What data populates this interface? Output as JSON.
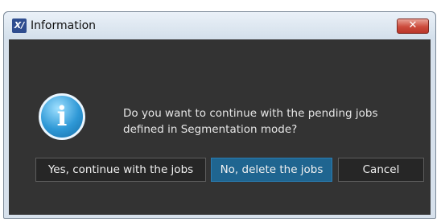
{
  "window": {
    "title": "Information",
    "close_symbol": "✕",
    "app_icon_text": "X/"
  },
  "dialog": {
    "message_line1": "Do you want to continue with the pending jobs",
    "message_line2": "defined in Segmentation mode?",
    "icon": "info-icon",
    "icon_glyph": "i"
  },
  "buttons": {
    "yes_label": "Yes, continue with the jobs",
    "no_label": "No, delete the jobs",
    "cancel_label": "Cancel"
  },
  "colors": {
    "content_bg": "#333333",
    "primary_button": "#1f6590",
    "close_button": "#cc4b3c"
  }
}
